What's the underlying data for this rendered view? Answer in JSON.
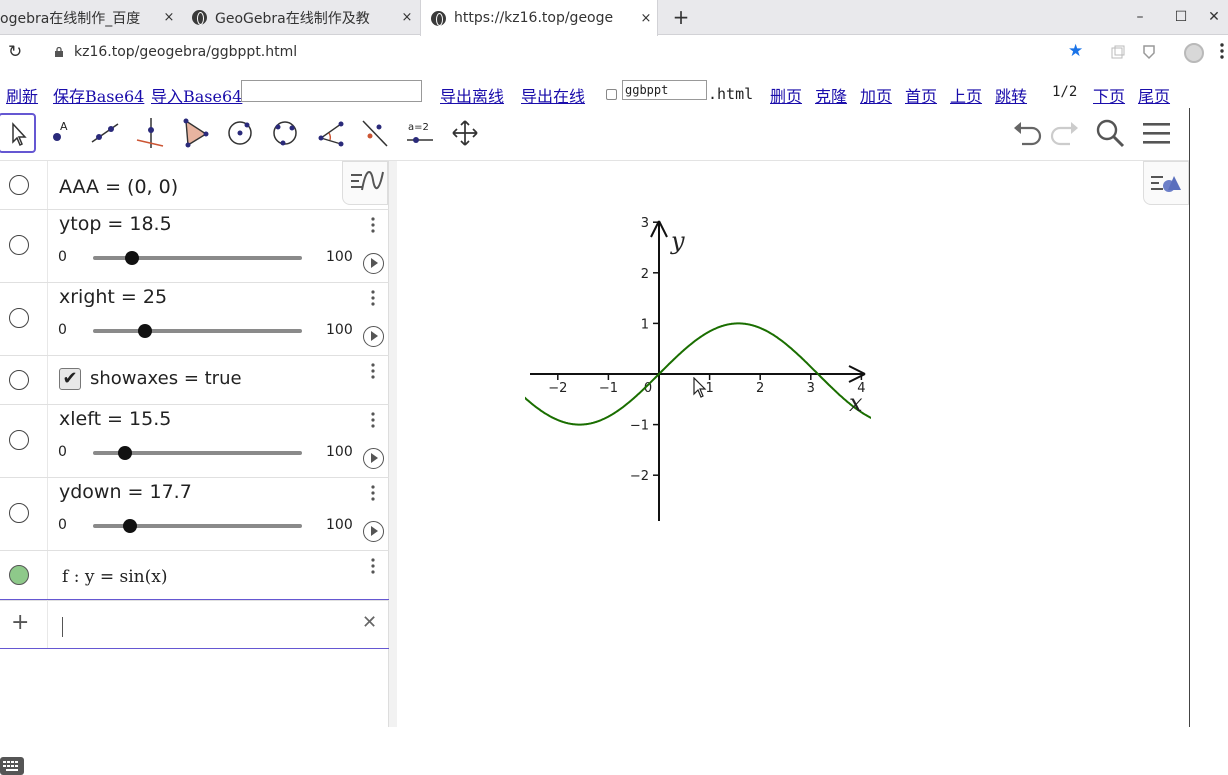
{
  "browser": {
    "tabs": [
      {
        "title": "ogebra在线制作_百度",
        "close": "×"
      },
      {
        "title": "GeoGebra在线制作及教",
        "close": "×"
      },
      {
        "title": "https://kz16.top/geoge",
        "close": "×"
      }
    ],
    "new_tab": "+",
    "window_controls": [
      "–",
      "☐",
      "✕"
    ],
    "url": "kz16.top/geogebra/ggbppt.html",
    "reload_icon": "↻",
    "star_icon": "★"
  },
  "linkbar": {
    "refresh": "刷新",
    "save_base64": "保存Base64",
    "import_base64": "导入Base64",
    "base64_value": "",
    "export_offline": "导出离线",
    "export_online": "导出在线",
    "filename_value": "ggbppt",
    "ext": ".html",
    "delete_page": "删页",
    "clone": "克隆",
    "add_page": "加页",
    "first_page": "首页",
    "prev_page": "上页",
    "jump": "跳转",
    "page_indicator": "1/2",
    "next_page": "下页",
    "last_page": "尾页"
  },
  "toolbar": {
    "tools": [
      "move-tool",
      "point-tool",
      "line-tool",
      "perpendicular-tool",
      "polygon-tool",
      "circle-center-tool",
      "circle-three-points-tool",
      "angle-tool",
      "reflect-tool",
      "slider-tool",
      "move-graphics-tool"
    ],
    "slider_tool_label": "a=2"
  },
  "algebra": {
    "items": [
      {
        "text": "AAA = (0, 0)"
      },
      {
        "text": "ytop = 18.5",
        "min": "0",
        "max": "100",
        "value": 18.5
      },
      {
        "text": "xright = 25",
        "min": "0",
        "max": "100",
        "value": 25
      },
      {
        "text": "showaxes = true",
        "check": "✔"
      },
      {
        "text": "xleft = 15.5",
        "min": "0",
        "max": "100",
        "value": 15.5
      },
      {
        "text": "ydown = 17.7",
        "min": "0",
        "max": "100",
        "value": 17.7
      },
      {
        "text": "f : y = sin(x)"
      }
    ],
    "input_placeholder": "",
    "add_icon": "+",
    "clear_icon": "✕"
  },
  "graphics": {
    "axis_labels": {
      "x": "x",
      "y": "y"
    },
    "x_ticks": [
      "−2",
      "−1",
      "0",
      "1",
      "2",
      "3",
      "4"
    ],
    "y_ticks": [
      "3",
      "2",
      "1",
      "−1",
      "−2"
    ],
    "function_color": "#1a6e00"
  }
}
